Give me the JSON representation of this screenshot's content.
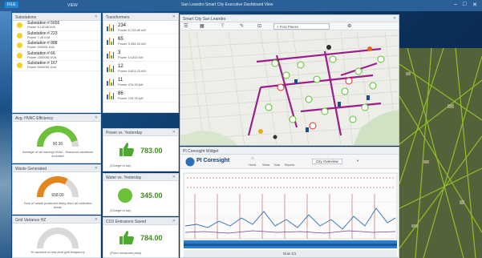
{
  "window": {
    "title": "San Leandro Smart City Executive Dashboard View",
    "tabs": [
      {
        "label": "FILE"
      },
      {
        "label": "VIEW"
      }
    ]
  },
  "substations": {
    "title": "Substations",
    "items": [
      {
        "name": "Substation # 5655",
        "sub": "Power 5.14048 kVA",
        "color": "#f2d21b"
      },
      {
        "name": "Substation # 223",
        "sub": "Power 7.45 kVA",
        "color": "#f2d21b"
      },
      {
        "name": "Substation # 888",
        "sub": "Power 200081 kVA",
        "color": "#f2d21b"
      },
      {
        "name": "Substation # 66",
        "sub": "Power 2300081 kVA",
        "color": "#f2d21b"
      },
      {
        "name": "Substation # 167",
        "sub": "Power 5000081 kVA",
        "color": "#f2d21b"
      }
    ]
  },
  "transformers": {
    "title": "Transformers",
    "items": [
      {
        "value": "234",
        "sub": "Power 6,743.89 kW"
      },
      {
        "value": "65",
        "sub": "Power 9,454.03 kW"
      },
      {
        "value": "3",
        "sub": "Power 14,843 kW"
      },
      {
        "value": "12",
        "sub": "Power 5,623.23 kW"
      },
      {
        "value": "11",
        "sub": "Power 476.39 kW"
      },
      {
        "value": "86",
        "sub": "Power 725.78 kW"
      }
    ]
  },
  "hvac": {
    "title": "Avg. HVAC Efficiency",
    "value": "90.30",
    "fraction": 0.9,
    "caption": "Average of all running HVAC. Seasonal variations included"
  },
  "waste": {
    "title": "Waste Generated",
    "value": "658.00",
    "fraction": 0.66,
    "caption": "Tons of waste produced today from all collection areas"
  },
  "gridfreq": {
    "title": "Grid Variance HZ",
    "value": "",
    "caption": "% variance in real-time grid frequency"
  },
  "power": {
    "title": "Power vs. Yesterday",
    "value": "783.00",
    "caption": "(Charge in kw)"
  },
  "water": {
    "title": "Water vs. Yesterday",
    "value": "345.00",
    "caption": "(Charge in kw)"
  },
  "co2": {
    "title": "CO2 Emissions Saved",
    "value": "784.00",
    "caption": "(From measured plus)"
  },
  "map": {
    "title": "Smart City San Leandro",
    "search_placeholder": "Find Places"
  },
  "widget": {
    "title": "PI Coresight Widget",
    "app": "PI Coresight",
    "nav": [
      "Home",
      "Views",
      "Tools",
      "Reports"
    ],
    "display": "City Overview",
    "time_label": "Show all",
    "bottom_label": "Now 1/1"
  },
  "colors": {
    "titlebar": "#2b5f98",
    "accent": "#1f86d8",
    "green": "#5bbf2a",
    "pipe": "#a0208a"
  }
}
